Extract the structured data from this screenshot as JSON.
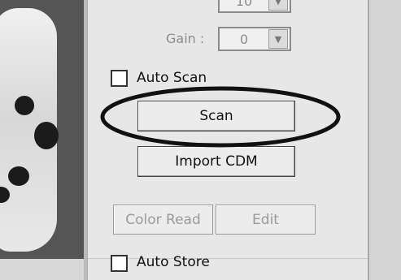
{
  "controls": {
    "top_field": {
      "value": "10"
    },
    "gain": {
      "label": "Gain :",
      "value": "0"
    }
  },
  "options": {
    "auto_scan_label": "Auto Scan",
    "auto_store_label": "Auto Store"
  },
  "buttons": {
    "scan": "Scan",
    "import_cdm": "Import CDM",
    "color_read": "Color Read",
    "edit": "Edit"
  },
  "annotation": {
    "shape": "ellipse",
    "color": "#111111",
    "highlights": "scan-button"
  },
  "icons": {
    "dropdown": "chevron-down-icon"
  }
}
